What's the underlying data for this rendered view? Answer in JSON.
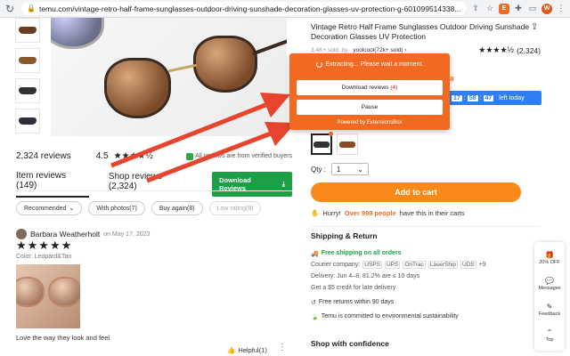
{
  "browser": {
    "url": "temu.com/vintage-retro-half-frame-sunglasses-outdoor-driving-sunshade-decoration-glasses-uv-protection-g-601099514338...",
    "avatar_letter": "W"
  },
  "product": {
    "title": "Vintage Retro Half Frame Sunglasses Outdoor Driving Sunshade Decoration Glasses UV Protection",
    "sold": "3.4K+ sold, by",
    "seller": "yoolcool(72k+ sold) ›",
    "stars": "★★★★½",
    "rating_count": "(2,324)",
    "deal_time": "48",
    "deal_h": "17",
    "deal_m": "58",
    "deal_s": "47",
    "deal_label": "left today",
    "qty_label": "Qty :",
    "qty_value": "1",
    "cart_label": "Add to cart",
    "hurry_pre": "Hurry!",
    "hurry_hl": "Over 999 people",
    "hurry_post": "have this in their carts"
  },
  "shipping": {
    "heading": "Shipping & Return",
    "free": "Free shipping on all orders",
    "courier_label": "Courier company:",
    "carriers": [
      "USPS",
      "UPS",
      "OnTrac",
      "LaserShip",
      "UDS"
    ],
    "carriers_more": "+9",
    "delivery": "Delivery: Jun 4–8, 81.2% are ≤ 10 days",
    "credit": "Get a $5 credit for late delivery",
    "returns": "Free returns within 90 days",
    "sustain": "Temu is committed to environmental sustainability",
    "confidence": "Shop with confidence"
  },
  "reviews": {
    "count": "2,324 reviews",
    "rating": "4.5",
    "stars": "★★★★½",
    "verified": "All reviews are from verified buyers",
    "tab_items": "Item reviews (149)",
    "tab_shop": "Shop reviews (2,324)",
    "download_btn": "Download Reviews",
    "chips": [
      "Recommended",
      "With photos(7)",
      "Buy again(8)",
      "Low rating(8)"
    ],
    "reviewer": "Barbara Weatherholt",
    "date": "on May 17, 2023",
    "review_stars": "★★★★★",
    "color": "Color: Leopard&Tan",
    "text": "Love the way they look and feel",
    "helpful": "Helpful(1)"
  },
  "popup": {
    "status": "Extracting... Please wait a moment.",
    "download_label": "Download reviews",
    "download_count": "(4)",
    "pause_label": "Pause",
    "footer": "Powered by ExtensionsBox"
  },
  "float_bar": {
    "discount": "20% OFF",
    "messages": "Messages",
    "feedback": "Feedback",
    "top": "Top"
  },
  "colors": {
    "accent": "#f98a19",
    "popup": "#f26a21",
    "green": "#1e9e45",
    "blue": "#2f7ff0",
    "arrow": "#e8432c"
  }
}
